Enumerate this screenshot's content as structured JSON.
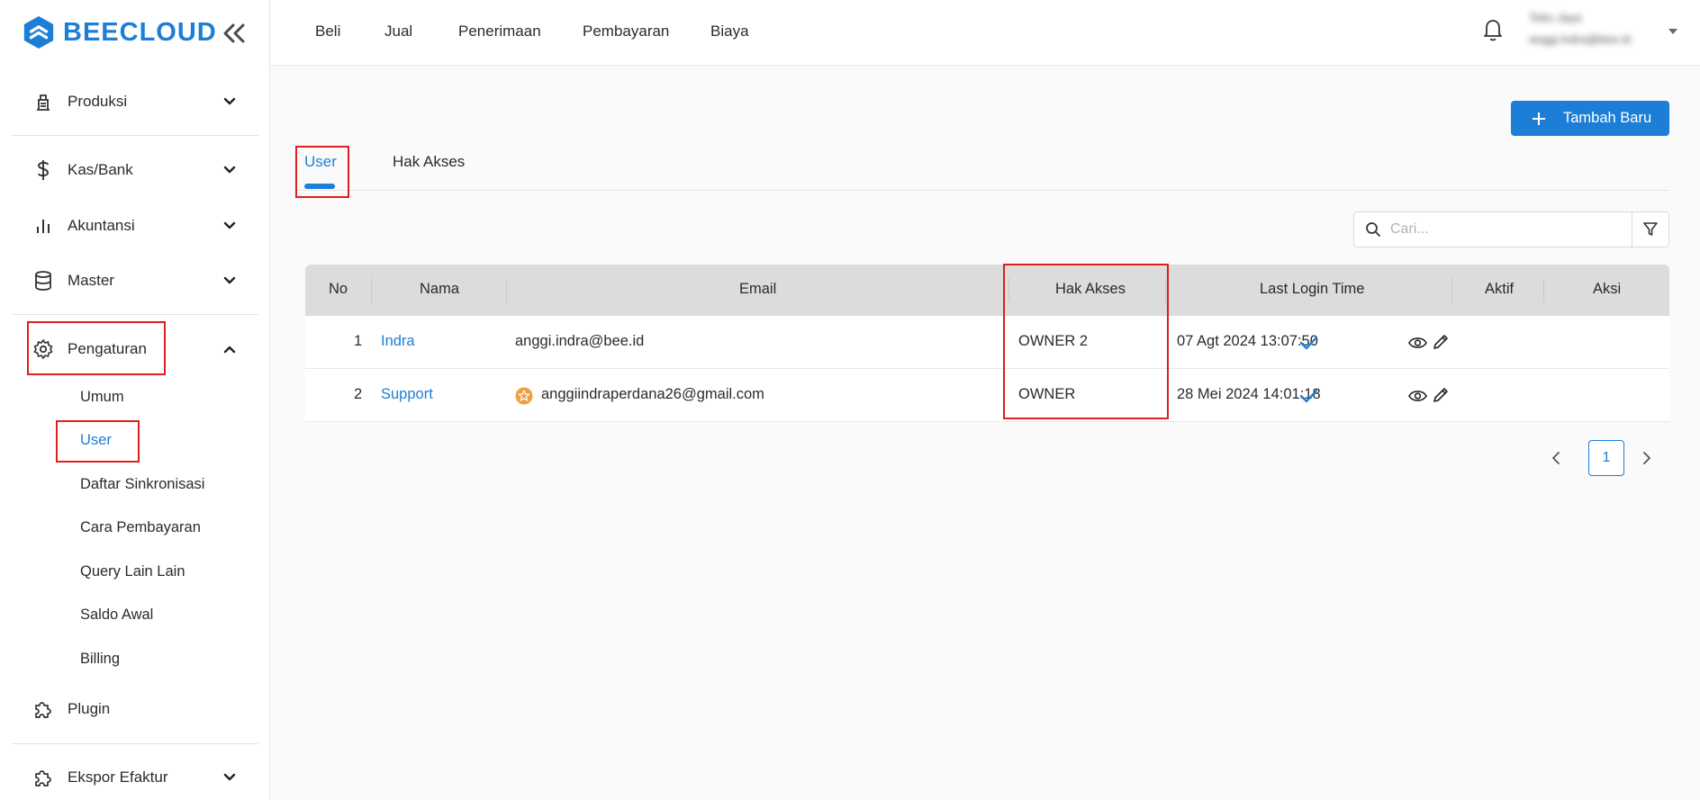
{
  "brand": {
    "name": "BEECLOUD"
  },
  "sidebar": {
    "items": [
      {
        "label": "Produksi",
        "icon": "factory-icon"
      },
      {
        "label": "Kas/Bank",
        "icon": "dollar-icon"
      },
      {
        "label": "Akuntansi",
        "icon": "bar-chart-icon"
      },
      {
        "label": "Master",
        "icon": "database-icon"
      },
      {
        "label": "Pengaturan",
        "icon": "gear-icon"
      },
      {
        "label": "Plugin",
        "icon": "puzzle-icon"
      },
      {
        "label": "Ekspor Efaktur",
        "icon": "puzzle-icon"
      }
    ],
    "sub_items": [
      "Umum",
      "User",
      "Daftar Sinkronisasi",
      "Cara Pembayaran",
      "Query Lain Lain",
      "Saldo Awal",
      "Billing"
    ],
    "active_sub": "User"
  },
  "topbar": {
    "menu": [
      "Beli",
      "Jual",
      "Penerimaan",
      "Pembayaran",
      "Biaya"
    ],
    "user_name": "Toko Jaya",
    "user_email": "anggi.indra@bee.id"
  },
  "toolbar": {
    "add_label": "Tambah Baru"
  },
  "tabs": [
    {
      "label": "User",
      "active": true
    },
    {
      "label": "Hak Akses",
      "active": false
    }
  ],
  "search": {
    "placeholder": "Cari..."
  },
  "table": {
    "headers": [
      "No",
      "Nama",
      "Email",
      "Hak Akses",
      "Last Login Time",
      "Aktif",
      "Aksi"
    ],
    "rows": [
      {
        "no": "1",
        "nama": "Indra",
        "email": "anggi.indra@bee.id",
        "hak_akses": "OWNER 2",
        "last_login": "07 Agt 2024 13:07:50",
        "aktif": true,
        "owner_badge": false
      },
      {
        "no": "2",
        "nama": "Support",
        "email": "anggiindraperdana26@gmail.com",
        "hak_akses": "OWNER",
        "last_login": "28 Mei 2024 14:01:18",
        "aktif": true,
        "owner_badge": true
      }
    ]
  },
  "pagination": {
    "current_page": "1"
  },
  "colors": {
    "accent": "#1c7ed6",
    "highlight": "#e01e1e",
    "header_bg": "#dcdcdc",
    "badge": "#f0a040"
  }
}
